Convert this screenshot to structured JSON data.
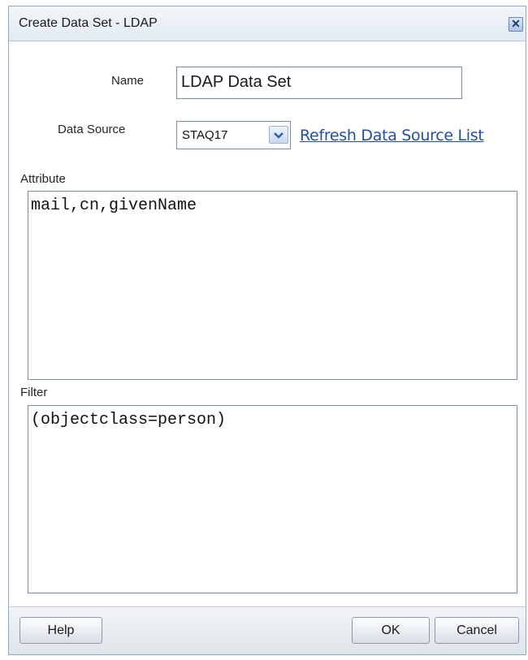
{
  "dialog": {
    "title": "Create Data Set - LDAP",
    "close_icon": "close-icon",
    "colors": {
      "titlebar": "#e1e9f3",
      "border": "#8eaac8",
      "link": "#1f4fa1"
    }
  },
  "form": {
    "name_label": "Name",
    "name_value": "LDAP Data Set",
    "data_source_label": "Data Source",
    "data_source_value": "STAQ17",
    "refresh_link": "Refresh Data Source List",
    "attribute_label": "Attribute",
    "attribute_value": "mail,cn,givenName",
    "filter_label": "Filter",
    "filter_value": "(objectclass=person)"
  },
  "footer": {
    "help_label": "Help",
    "ok_label": "OK",
    "cancel_label": "Cancel"
  }
}
